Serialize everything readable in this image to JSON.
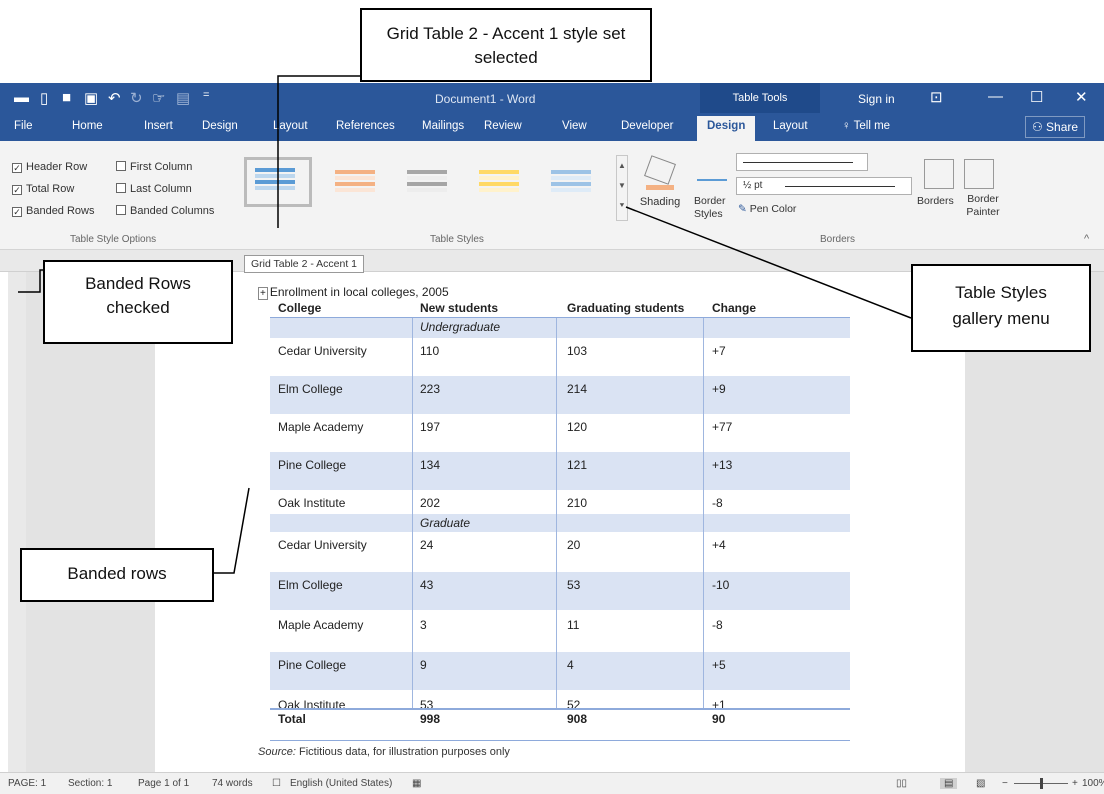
{
  "window": {
    "title": "Document1 - Word",
    "context_tab_group": "Table Tools",
    "sign_in": "Sign in",
    "share": "Share"
  },
  "tabs": [
    "File",
    "Home",
    "Insert",
    "Design",
    "Layout",
    "References",
    "Mailings",
    "Review",
    "View",
    "Developer",
    "Design",
    "Layout"
  ],
  "tell_me": "Tell me",
  "ribbon": {
    "style_options": {
      "header_row": "Header Row",
      "total_row": "Total Row",
      "banded_rows": "Banded Rows",
      "first_column": "First Column",
      "last_column": "Last Column",
      "banded_columns": "Banded Columns",
      "group_label": "Table Style Options"
    },
    "table_styles_label": "Table Styles",
    "shading": "Shading",
    "border_styles": "Border Styles",
    "pen_weight": "½ pt",
    "pen_color": "Pen Color",
    "borders": "Borders",
    "border_painter": "Border Painter",
    "borders_group": "Borders"
  },
  "tooltip": "Grid Table 2 - Accent 1",
  "table": {
    "caption": "Enrollment in local colleges, 2005",
    "headers": [
      "College",
      "New students",
      "Graduating students",
      "Change"
    ],
    "undergraduate_label": "Undergraduate",
    "graduate_label": "Graduate",
    "undergraduate": [
      [
        "Cedar University",
        "110",
        "103",
        "+7"
      ],
      [
        "Elm College",
        "223",
        "214",
        "+9"
      ],
      [
        "Maple Academy",
        "197",
        "120",
        "+77"
      ],
      [
        "Pine College",
        "134",
        "121",
        "+13"
      ],
      [
        "Oak Institute",
        "202",
        "210",
        "-8"
      ]
    ],
    "graduate": [
      [
        "Cedar University",
        "24",
        "20",
        "+4"
      ],
      [
        "Elm College",
        "43",
        "53",
        "-10"
      ],
      [
        "Maple Academy",
        "3",
        "11",
        "-8"
      ],
      [
        "Pine College",
        "9",
        "4",
        "+5"
      ],
      [
        "Oak Institute",
        "53",
        "52",
        "+1"
      ]
    ],
    "total": [
      "Total",
      "998",
      "908",
      "90"
    ],
    "source_label": "Source:",
    "source_text": " Fictitious data, for illustration purposes only"
  },
  "status": {
    "page": "PAGE: 1",
    "section": "Section: 1",
    "page_of": "Page 1 of 1",
    "words": "74 words",
    "language": "English (United States)",
    "zoom": "100%"
  },
  "callouts": {
    "gallery_selected": "Grid Table 2 - Accent 1 style set selected",
    "banded_rows_checked": "Banded Rows checked",
    "table_styles_menu": "Table Styles gallery menu",
    "banded_rows": "Banded rows"
  },
  "colors": {
    "accent": "#2b579a",
    "band": "#dae3f3"
  }
}
